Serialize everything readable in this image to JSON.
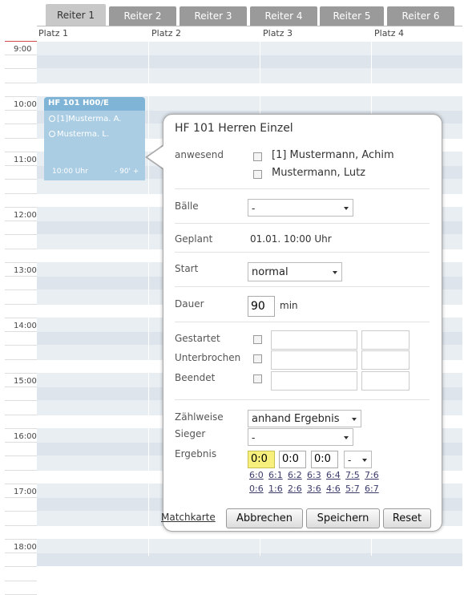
{
  "tabs": [
    "Reiter 1",
    "Reiter 2",
    "Reiter 3",
    "Reiter 4",
    "Reiter 5",
    "Reiter 6"
  ],
  "columns": [
    "Platz 1",
    "Platz 2",
    "Platz 3",
    "Platz 4"
  ],
  "times": [
    "9:00",
    "10:00",
    "11:00",
    "12:00",
    "13:00",
    "14:00",
    "15:00",
    "16:00",
    "17:00",
    "18:00"
  ],
  "event": {
    "title": "HF 101 H00/E",
    "player1": "[1]Musterma. A.",
    "player2": "Musterma. L.",
    "time": "10:00 Uhr",
    "duration": "- 90' +"
  },
  "popup": {
    "title": "HF 101 Herren Einzel",
    "anwesend_label": "anwesend",
    "player1": "[1] Mustermann, Achim",
    "player2": "Mustermann, Lutz",
    "baelle_label": "Bälle",
    "baelle_value": "-",
    "geplant_label": "Geplant",
    "geplant_value": "01.01. 10:00 Uhr",
    "start_label": "Start",
    "start_value": "normal",
    "dauer_label": "Dauer",
    "dauer_value": "90",
    "dauer_unit": "min",
    "gestartet_label": "Gestartet",
    "unterbrochen_label": "Unterbrochen",
    "beendet_label": "Beendet",
    "zaehlweise_label": "Zählweise",
    "zaehlweise_value": "anhand Ergebnis",
    "sieger_label": "Sieger",
    "sieger_value": "-",
    "ergebnis_label": "Ergebnis",
    "score1": "0:0",
    "score2": "0:0",
    "score3": "0:0",
    "score_select": "-",
    "quick_row1": [
      "6:0",
      "6:1",
      "6:2",
      "6:3",
      "6:4",
      "7:5",
      "7:6"
    ],
    "quick_row2": [
      "0:6",
      "1:6",
      "2:6",
      "3:6",
      "4:6",
      "5:7",
      "6:7"
    ],
    "matchkarte": "Matchkarte",
    "abbrechen": "Abbrechen",
    "speichern": "Speichern",
    "reset": "Reset"
  }
}
